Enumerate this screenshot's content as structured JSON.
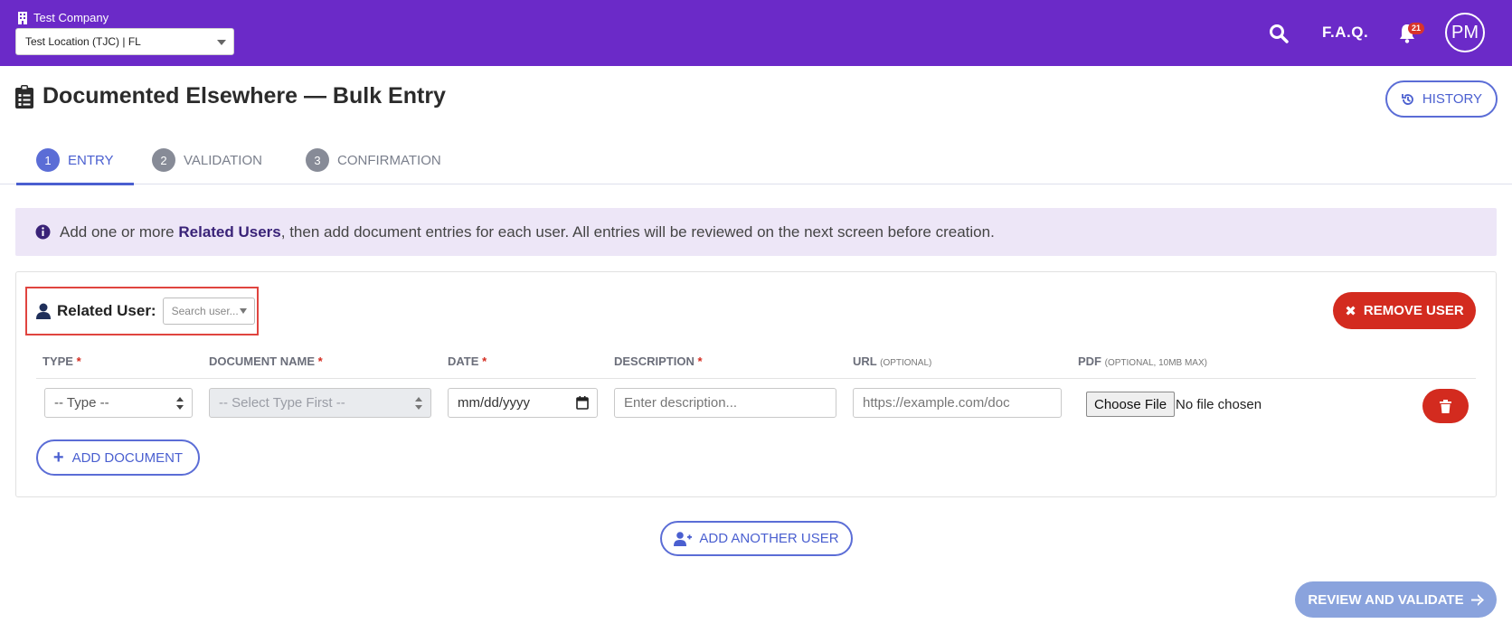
{
  "header": {
    "company": "Test Company",
    "location_select": "Test Location (TJC) | FL",
    "faq_label": "F.A.Q.",
    "notifications_count": "21",
    "avatar_initials": "PM",
    "brand_color": "#6b2ac8"
  },
  "page": {
    "title": "Documented Elsewhere — Bulk Entry",
    "history_label": "HISTORY"
  },
  "steps": [
    {
      "num": "1",
      "label": "ENTRY",
      "active": true
    },
    {
      "num": "2",
      "label": "VALIDATION",
      "active": false
    },
    {
      "num": "3",
      "label": "CONFIRMATION",
      "active": false
    }
  ],
  "info": {
    "prefix": "Add one or more ",
    "bold": "Related Users",
    "suffix": ", then add document entries for each user. All entries will be reviewed on the next screen before creation."
  },
  "user_card": {
    "related_user_label": "Related User:",
    "user_select_placeholder": "Search user...",
    "remove_user_label": "REMOVE USER",
    "columns": {
      "type": "TYPE",
      "document_name": "DOCUMENT NAME",
      "date": "DATE",
      "description": "DESCRIPTION",
      "url": "URL",
      "url_note": "(OPTIONAL)",
      "pdf": "PDF",
      "pdf_note": "(OPTIONAL, 10MB MAX)",
      "required_mark": "*"
    },
    "row": {
      "type_value": "-- Type --",
      "document_name_value": "-- Select Type First --",
      "date_placeholder": "mm/dd/yyyy",
      "description_placeholder": "Enter description...",
      "url_placeholder": "https://example.com/doc",
      "choose_file_label": "Choose File",
      "file_status": "No file chosen"
    },
    "add_document_label": "ADD DOCUMENT"
  },
  "actions": {
    "add_another_user_label": "ADD ANOTHER USER",
    "review_label": "REVIEW AND VALIDATE"
  },
  "colors": {
    "accent": "#4a5fd0",
    "danger": "#d32b1f",
    "info_bg": "#ede6f7"
  }
}
